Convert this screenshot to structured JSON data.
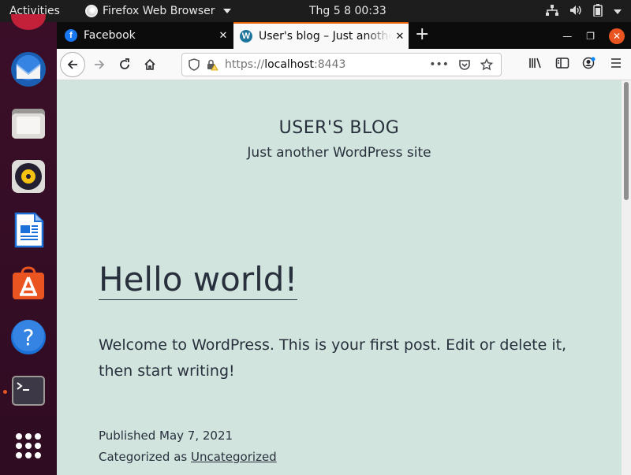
{
  "topbar": {
    "activities": "Activities",
    "app_menu": "Firefox Web Browser",
    "clock": "Thg 5 8  00:33",
    "tray_icons": [
      "network-icon",
      "volume-icon",
      "battery-icon",
      "power-menu-icon"
    ]
  },
  "dock": {
    "items": [
      "thunderbird",
      "files",
      "rhythmbox",
      "libreoffice-writer",
      "software-center",
      "help",
      "terminal",
      "show-applications"
    ],
    "accent": "#e95420"
  },
  "browser": {
    "tabs": [
      {
        "title": "Facebook",
        "favicon": "facebook-icon",
        "favicon_glyph": "f",
        "active": false
      },
      {
        "title": "User's blog – Just another WordPress site",
        "favicon": "wordpress-icon",
        "favicon_glyph": "W",
        "active": true
      }
    ],
    "new_tab": "+",
    "url_prefix": "https://",
    "url_host": "localhost",
    "url_port": ":8443"
  },
  "page": {
    "site_title": "USER'S BLOG",
    "site_description": "Just another WordPress site",
    "post_title": "Hello world!",
    "post_body": "Welcome to WordPress. This is your first post. Edit or delete it, then start writing!",
    "published_label": "Published",
    "published_date": "May 7, 2021",
    "category_label": "Categorized as",
    "category": "Uncategorized",
    "background": "#d1e4dd"
  }
}
